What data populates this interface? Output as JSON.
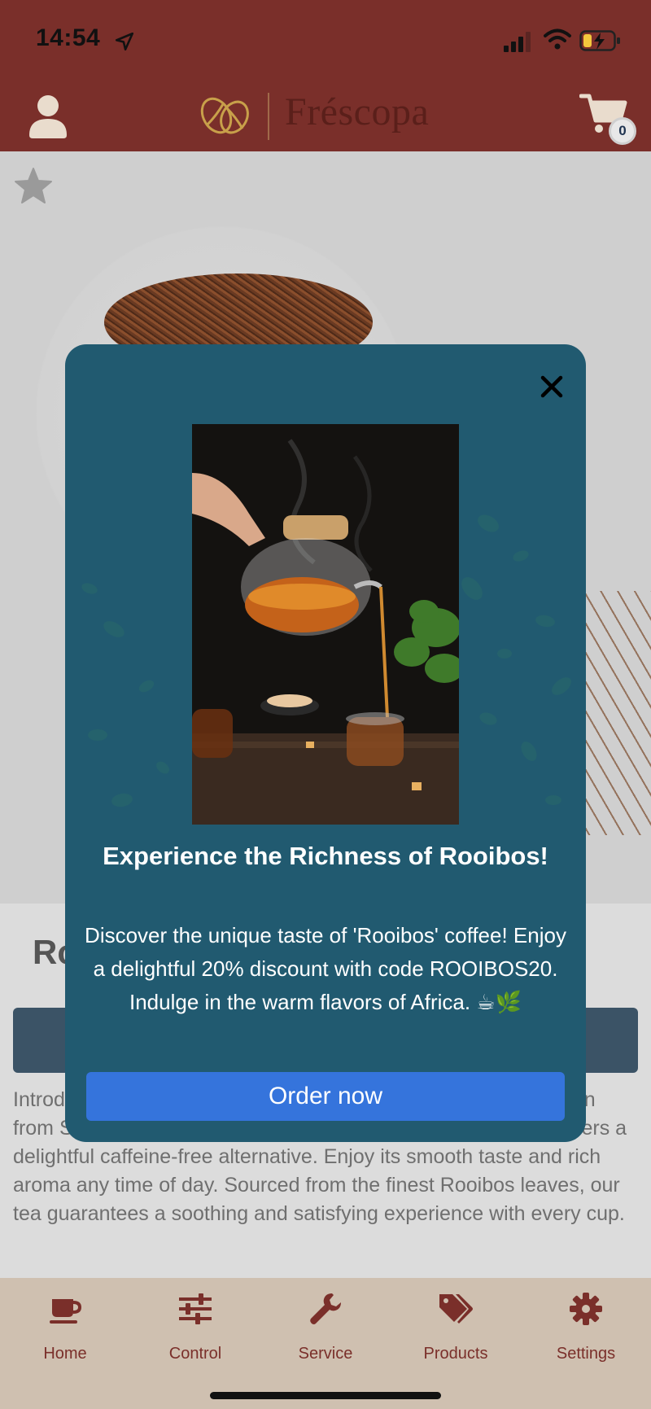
{
  "status_bar": {
    "time": "14:54"
  },
  "header": {
    "brand": "Fréscopa",
    "cart_count": "0"
  },
  "product": {
    "title": "Rooibos",
    "description": "Introducing our premium Rooibos tea, a delightful herbal infusion from South Africa. Known for its natural sweetness, Rooibos offers a delightful caffeine-free alternative. Enjoy its smooth taste and rich aroma any time of day. Sourced from the finest Rooibos leaves, our tea guarantees a soothing and satisfying experience with every cup."
  },
  "modal": {
    "title": "Experience the Richness of Rooibos!",
    "body": "Discover the unique taste of 'Rooibos' coffee! Enjoy a delightful 20% discount with code ROOIBOS20. Indulge in the warm flavors of Africa. ☕🌿",
    "button_label": "Order now"
  },
  "tabbar": {
    "items": [
      {
        "label": "Home",
        "icon": "coffee-cup-icon"
      },
      {
        "label": "Control",
        "icon": "sliders-icon"
      },
      {
        "label": "Service",
        "icon": "wrench-icon"
      },
      {
        "label": "Products",
        "icon": "tags-icon"
      },
      {
        "label": "Settings",
        "icon": "gear-icon"
      }
    ]
  },
  "colors": {
    "header_bg": "#7a2f2a",
    "modal_bg": "#215a70",
    "button_blue": "#3574dc",
    "tabbar_bg": "#cfc0b0"
  }
}
